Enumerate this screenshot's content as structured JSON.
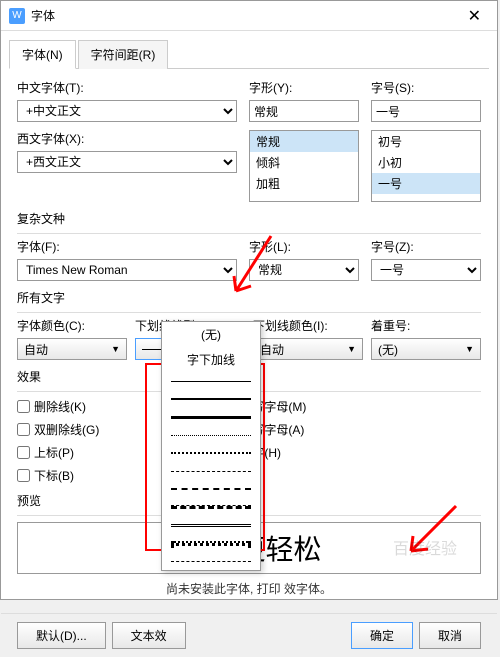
{
  "titlebar": {
    "icon": "W",
    "title": "字体"
  },
  "tabs": {
    "font": "字体(N)",
    "spacing": "字符间距(R)"
  },
  "cn_font": {
    "label": "中文字体(T):",
    "value": "+中文正文"
  },
  "style_top": {
    "label": "字形(Y):",
    "value": "常规",
    "options": [
      "常规",
      "倾斜",
      "加粗"
    ]
  },
  "size_top": {
    "label": "字号(S):",
    "value": "一号",
    "options": [
      "初号",
      "小初",
      "一号"
    ]
  },
  "west_font": {
    "label": "西文字体(X):",
    "value": "+西文正文"
  },
  "complex_title": "复杂文种",
  "complex_font": {
    "label": "字体(F):",
    "value": "Times New Roman"
  },
  "complex_style": {
    "label": "字形(L):",
    "value": "常规"
  },
  "complex_size": {
    "label": "字号(Z):",
    "value": "一号"
  },
  "all_text_title": "所有文字",
  "font_color": {
    "label": "字体颜色(C):",
    "value": "自动"
  },
  "underline": {
    "label": "下划线线型(U):",
    "value": ""
  },
  "underline_color": {
    "label": "下划线颜色(I):",
    "value": "自动"
  },
  "emphasis": {
    "label": "着重号:",
    "value": "(无)"
  },
  "effects_title": "效果",
  "checks_left": [
    {
      "label": "删除线(K)"
    },
    {
      "label": "双删除线(G)"
    },
    {
      "label": "上标(P)"
    },
    {
      "label": "下标(B)"
    }
  ],
  "checks_right": [
    {
      "label": "小型大写字母(M)"
    },
    {
      "label": "全部大写字母(A)"
    },
    {
      "label": "隐藏文字(H)"
    }
  ],
  "preview_title": "预览",
  "preview_text": "W          公更轻松",
  "note_text": "尚未安装此字体, 打印                     效字体。",
  "dropdown_menu": {
    "none": "(无)",
    "words": "字下加线"
  },
  "buttons": {
    "default": "默认(D)...",
    "text_effect": "文本效",
    "ok": "确定",
    "cancel": "取消"
  },
  "watermark": "百度经验"
}
